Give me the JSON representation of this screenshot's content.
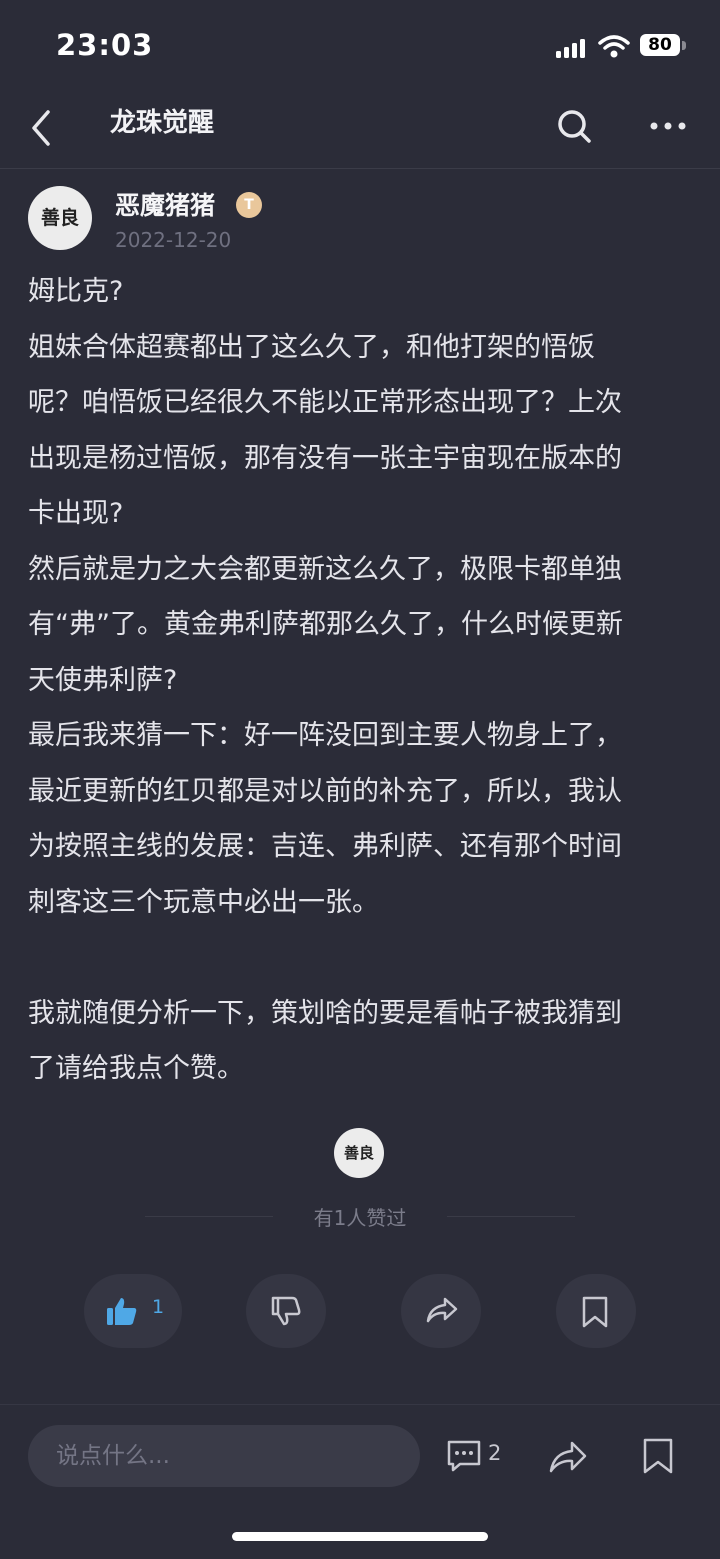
{
  "status_bar": {
    "time": "23:03",
    "battery": "80"
  },
  "nav": {
    "title": "龙珠觉醒"
  },
  "post": {
    "author": {
      "avatar_text": "善良",
      "name": "恶魔猪猪",
      "level_badge": "T",
      "date": "2022-12-20"
    },
    "lines": [
      "姆比克?",
      "姐妹合体超赛都出了这么久了，和他打架的悟饭",
      "呢？咱悟饭已经很久不能以正常形态出现了？上次",
      "出现是杨过悟饭，那有没有一张主宇宙现在版本的",
      "卡出现?",
      "然后就是力之大会都更新这么久了，极限卡都单独",
      "有“弗”了。黄金弗利萨都那么久了，什么时候更新",
      "天使弗利萨?",
      "最后我来猜一下：好一阵没回到主要人物身上了，",
      "最近更新的红贝都是对以前的补充了，所以，我认",
      "为按照主线的发展：吉连、弗利萨、还有那个时间",
      "刺客这三个玩意中必出一张。",
      "",
      "我就随便分析一下，策划啥的要是看帖子被我猜到",
      "了请给我点个赞。"
    ]
  },
  "likes": {
    "liker_avatar_text": "善良",
    "summary": "有1人赞过"
  },
  "actions": {
    "like_count": "1"
  },
  "bottom_bar": {
    "comment_placeholder": "说点什么...",
    "comment_count": "2"
  },
  "colors": {
    "background": "#2b2c38",
    "accent": "#4fa8e6"
  }
}
